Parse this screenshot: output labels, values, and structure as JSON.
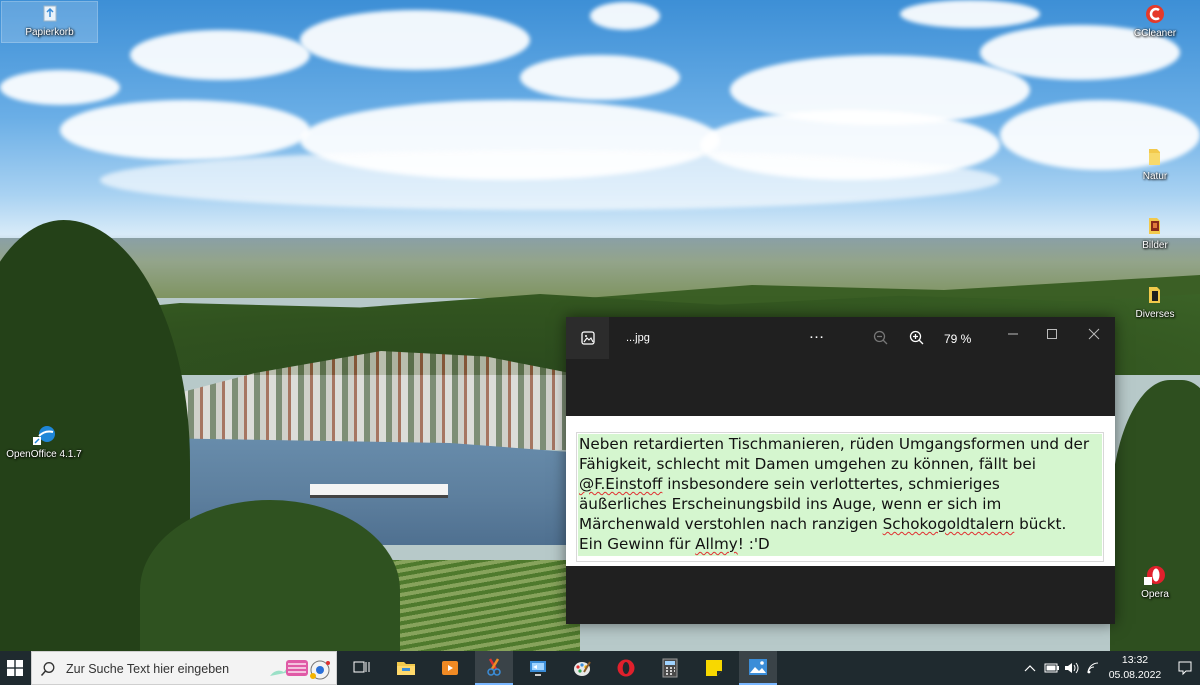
{
  "desktop": {
    "icons": {
      "recycle_bin": "Papierkorb",
      "ccleaner": "CCleaner",
      "natur": "Natur",
      "bilder": "Bilder",
      "diverses": "Diverses",
      "openoffice": "OpenOffice 4.1.7",
      "opera": "Opera"
    }
  },
  "viewer": {
    "file_name": "...jpg",
    "more_label": "…",
    "zoom_value": "79 %",
    "text": {
      "line1": "Neben retardierten Tischmanieren, rüden Umgangsformen und der",
      "line2": "Fähigkeit, schlecht mit Damen umgehen zu können, fällt bei",
      "line3_handle": "@F.Einstoff",
      "line3_rest": " insbesondere sein verlottertes, schmieriges",
      "line4": "äußerliches Erscheinungsbild ins Auge, wenn er sich im",
      "line5_start": "Märchenwald verstohlen nach ranzigen ",
      "line5_word": "Schokogoldtalern",
      "line5_end": " bückt.",
      "line6_start": "Ein Gewinn für ",
      "line6_word": "Allmy",
      "line6_end": "! :'D"
    }
  },
  "taskbar": {
    "search_placeholder": "Zur Suche Text hier eingeben",
    "clock_time": "13:32",
    "clock_date": "05.08.2022"
  },
  "colors": {
    "text_highlight": "#d5f6cf",
    "taskbar": "#1f2a2f",
    "viewer_bg": "#202020",
    "spellcheck": "#e03030"
  }
}
